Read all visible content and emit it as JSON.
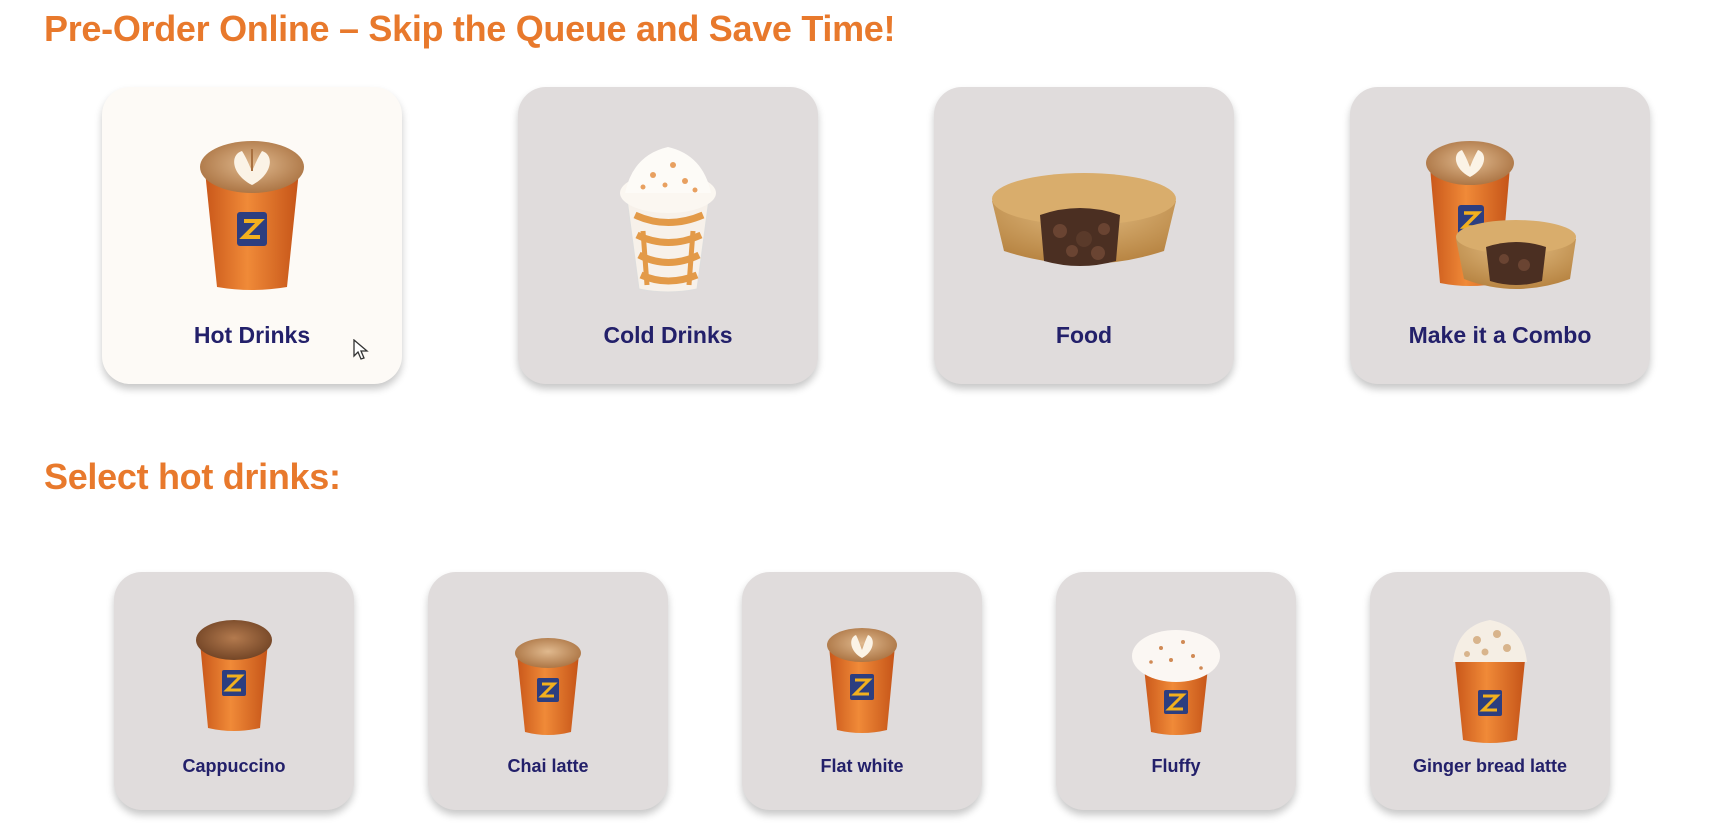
{
  "headings": {
    "main": "Pre-Order Online – Skip the Queue and Save Time!",
    "section": "Select hot drinks:"
  },
  "categories": [
    {
      "label": "Hot Drinks",
      "icon": "coffee-cup-latte-art-icon",
      "selected": true
    },
    {
      "label": "Cold Drinks",
      "icon": "iced-drink-whipped-cream-icon",
      "selected": false
    },
    {
      "label": "Food",
      "icon": "meat-pie-icon",
      "selected": false
    },
    {
      "label": "Make it a Combo",
      "icon": "coffee-and-pie-icon",
      "selected": false
    }
  ],
  "items": [
    {
      "label": "Cappuccino",
      "icon": "cappuccino-cup-icon"
    },
    {
      "label": "Chai latte",
      "icon": "chai-latte-cup-icon"
    },
    {
      "label": "Flat white",
      "icon": "flat-white-cup-icon"
    },
    {
      "label": "Fluffy",
      "icon": "fluffy-cup-icon"
    },
    {
      "label": "Ginger bread latte",
      "icon": "gingerbread-latte-cup-icon"
    }
  ],
  "colors": {
    "heading": "#e8792c",
    "label": "#23206a",
    "card": "#e0dcdc",
    "card_selected": "#fdfaf6",
    "cup_orange": "#e8762a",
    "cup_badge": "#2c3e80"
  }
}
